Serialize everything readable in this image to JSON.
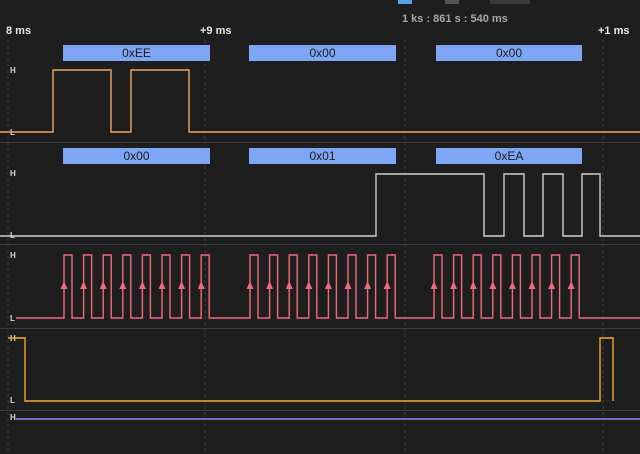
{
  "timeline": {
    "readout": "1 ks : 861 s : 540 ms",
    "ticks": [
      "8 ms",
      "+9 ms",
      "+1 ms"
    ]
  },
  "level_labels": {
    "high": "H",
    "low": "L"
  },
  "channels": [
    {
      "id": "mosi",
      "color": "#e9a56b",
      "frames": [
        "0xEE",
        "0x00",
        "0x00"
      ],
      "edges": [
        [
          0,
          "L"
        ],
        [
          53,
          "H"
        ],
        [
          111,
          "L"
        ],
        [
          131,
          "H"
        ],
        [
          189,
          "L"
        ],
        [
          640,
          "L"
        ]
      ]
    },
    {
      "id": "miso",
      "color": "#d0d0d0",
      "frames": [
        "0x00",
        "0x01",
        "0xEA"
      ],
      "edges": [
        [
          0,
          "L"
        ],
        [
          376,
          "H"
        ],
        [
          484,
          "L"
        ],
        [
          504,
          "H"
        ],
        [
          524,
          "L"
        ],
        [
          543,
          "H"
        ],
        [
          563,
          "L"
        ],
        [
          582,
          "H"
        ],
        [
          600,
          "L"
        ],
        [
          640,
          "L"
        ]
      ]
    },
    {
      "id": "clock",
      "color": "#ef6b7a",
      "bursts": [
        64,
        250,
        434
      ],
      "pulse_period": 19.6,
      "pulse_width": 8,
      "pulses_per_burst": 8
    },
    {
      "id": "enable",
      "color": "#f3a534",
      "edges": [
        [
          8,
          "H"
        ],
        [
          25,
          "L"
        ],
        [
          600,
          "H"
        ],
        [
          613,
          "H"
        ]
      ]
    },
    {
      "id": "aux",
      "color": "#8c8ce8",
      "level": "H"
    }
  ]
}
